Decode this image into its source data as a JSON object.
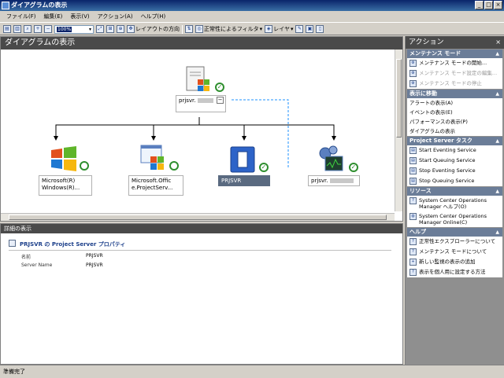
{
  "window": {
    "title": "ダイアグラムの表示",
    "minimize": "_",
    "maximize": "□",
    "close": "×"
  },
  "menu": [
    "ファイル(F)",
    "編集(E)",
    "表示(V)",
    "アクション(A)",
    "ヘルプ(H)"
  ],
  "toolbar": {
    "zoom_value": "100%",
    "layout_direction": "レイアウトの方向",
    "health_filter": "正常性によるフィルタ",
    "layer": "レイヤ"
  },
  "diagram": {
    "title": "ダイアグラムの表示",
    "root": {
      "name": "prjsvr.",
      "collapse": "−"
    },
    "children": [
      {
        "line1": "Microsoft(R)",
        "line2": "Windows(R)..."
      },
      {
        "line1": "Microsoft.Offic",
        "line2": "e.ProjectServ..."
      },
      {
        "line1": "PRJSVR",
        "line2": ""
      },
      {
        "line1": "prjsvr.",
        "line2": ""
      }
    ]
  },
  "details": {
    "header": "詳細の表示",
    "title": "PRJSVR の Project Server プロパティ",
    "rows": [
      {
        "label": "名前",
        "value": "PRJSVR"
      },
      {
        "label": "Server Name",
        "value": "PRJSVR"
      }
    ]
  },
  "actions": {
    "header": "アクション",
    "close": "×",
    "sections": [
      {
        "title": "メンテナンス モード",
        "items": [
          {
            "label": "メンテナンス モードの開始...",
            "disabled": false
          },
          {
            "label": "メンテナンス モード設定の編集...",
            "disabled": true
          },
          {
            "label": "メンテナンス モードの停止",
            "disabled": true
          }
        ]
      },
      {
        "title": "表示に移動",
        "items": [
          {
            "label": "アラートの表示(A)"
          },
          {
            "label": "イベントの表示(E)"
          },
          {
            "label": "パフォーマンスの表示(P)"
          },
          {
            "label": "ダイアグラムの表示"
          }
        ]
      },
      {
        "title": "Project Server タスク",
        "items": [
          {
            "label": "Start Eventing Service"
          },
          {
            "label": "Start Queuing Service"
          },
          {
            "label": "Stop Eventing Service"
          },
          {
            "label": "Stop Queuing Service"
          }
        ]
      },
      {
        "title": "リソース",
        "items": [
          {
            "label": "System Center Operations Manager ヘルプ(O)"
          },
          {
            "label": "System Center Operations Manager Online(C)"
          }
        ]
      },
      {
        "title": "ヘルプ",
        "items": [
          {
            "label": "正常性エクスプローラーについて"
          },
          {
            "label": "メンテナンス モードについて"
          },
          {
            "label": "新しい監視の表示の追加"
          },
          {
            "label": "表示を個人用に設定する方法"
          }
        ]
      }
    ]
  },
  "status": {
    "text": "準備完了"
  },
  "colors": {
    "titlebar": "#0a246a",
    "pane_header": "#4a4a4a",
    "section_header": "#6b7d98",
    "healthy": "#2f8f2f",
    "link_arrow": "#1e90ff"
  }
}
